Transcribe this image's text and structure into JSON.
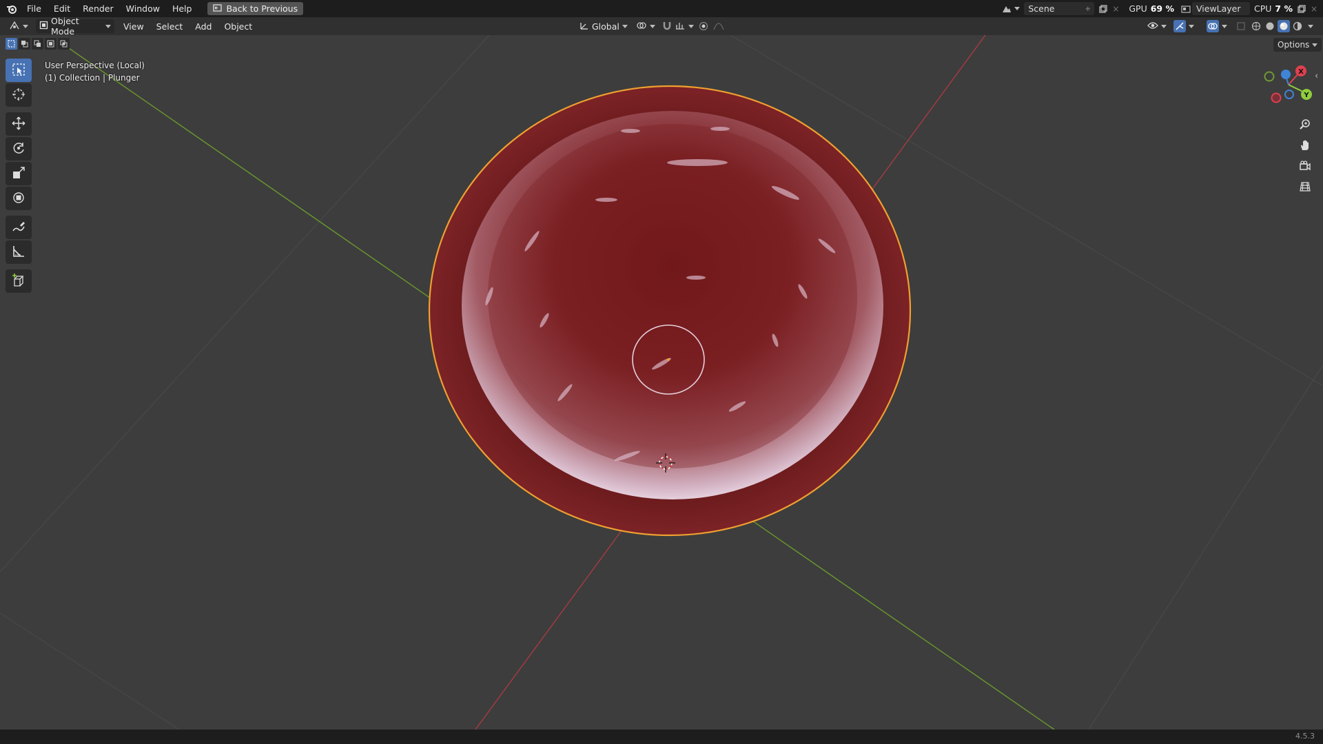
{
  "menubar": {
    "items": [
      "File",
      "Edit",
      "Render",
      "Window",
      "Help"
    ],
    "back_button": "Back to Previous",
    "scene_label": "Scene",
    "viewlayer_label": "ViewLayer"
  },
  "performance": {
    "gpu_label": "GPU",
    "gpu_value": "69 %",
    "cpu_label": "CPU",
    "cpu_value": "7 %"
  },
  "viewport_header": {
    "mode": "Object Mode",
    "menus": [
      "View",
      "Select",
      "Add",
      "Object"
    ],
    "orientation": "Global",
    "options": "Options"
  },
  "viewport": {
    "perspective_label": "User Perspective (Local)",
    "collection_label": "(1) Collection | Plunger",
    "object_color": "#7a1f22",
    "selection_outline": "#f0a030"
  },
  "gizmo": {
    "x_label": "X",
    "y_label": "Y",
    "x_color": "#e0404f",
    "y_color": "#8fcd3c",
    "z_color": "#3f84d6"
  },
  "tools": [
    "select-box-icon",
    "cursor-icon",
    "move-icon",
    "rotate-icon",
    "scale-icon",
    "transform-icon",
    "annotate-icon",
    "measure-icon",
    "add-cube-icon"
  ],
  "status": {
    "version": "4.5.3"
  }
}
